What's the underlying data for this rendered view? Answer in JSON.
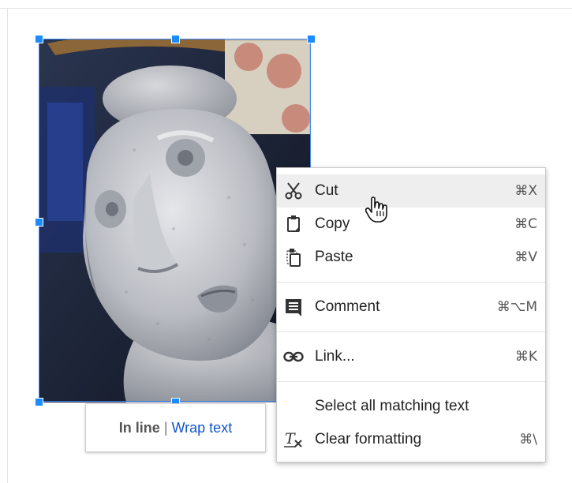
{
  "wrap_toolbar": {
    "inline_label": "In line",
    "separator": "|",
    "wrap_label": "Wrap text",
    "link_color": "#1155cc"
  },
  "context_menu": {
    "items": [
      {
        "label": "Cut",
        "shortcut": "⌘X",
        "icon": "scissors-icon",
        "highlighted": true
      },
      {
        "label": "Copy",
        "shortcut": "⌘C",
        "icon": "copy-icon"
      },
      {
        "label": "Paste",
        "shortcut": "⌘V",
        "icon": "paste-icon"
      },
      {
        "label": "Comment",
        "shortcut": "⌘⌥M",
        "icon": "comment-icon"
      },
      {
        "label": "Link...",
        "shortcut": "⌘K",
        "icon": "link-icon"
      },
      {
        "label": "Select all matching text",
        "shortcut": "",
        "icon": ""
      },
      {
        "label": "Clear formatting",
        "shortcut": "⌘\\",
        "icon": "clear-formatting-icon"
      }
    ]
  },
  "selection_color": "#4285f4",
  "highlight_color": "#eeeeee"
}
